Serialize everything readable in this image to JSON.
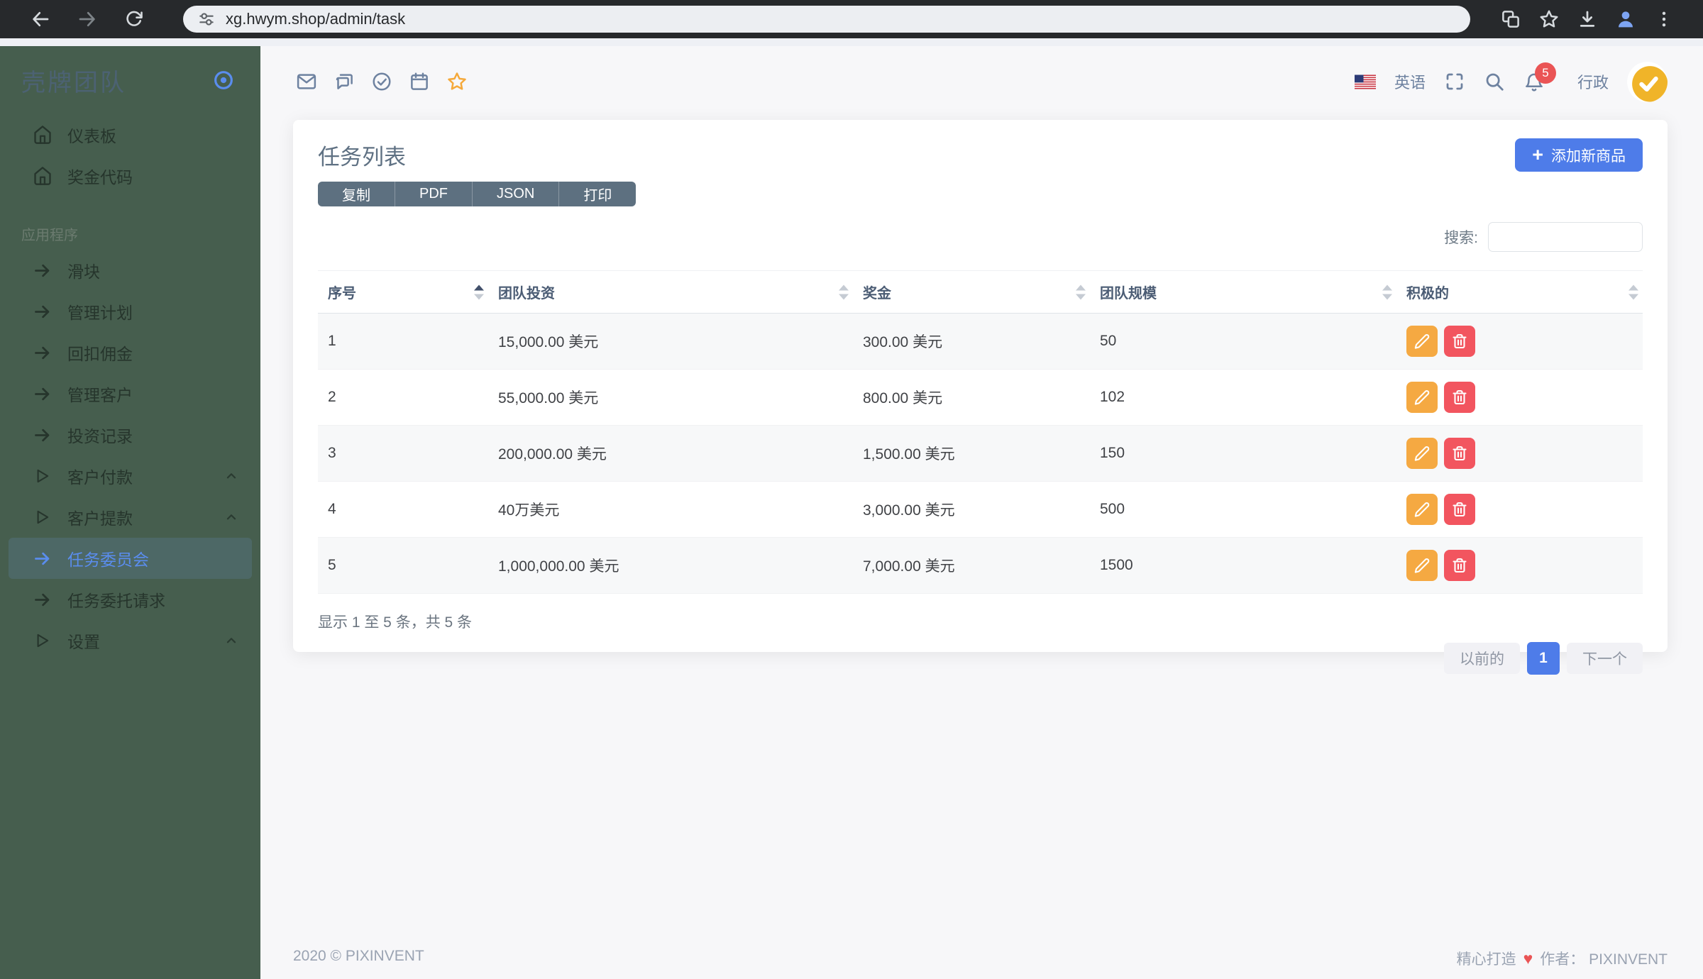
{
  "browser": {
    "url": "xg.hwym.shop/admin/task"
  },
  "sidebar": {
    "brand": "壳牌团队",
    "section_label": "应用程序",
    "items": [
      {
        "label": "仪表板",
        "icon": "home"
      },
      {
        "label": "奖金代码",
        "icon": "home"
      },
      {
        "label": "滑块",
        "icon": "arrow"
      },
      {
        "label": "管理计划",
        "icon": "arrow"
      },
      {
        "label": "回扣佣金",
        "icon": "arrow"
      },
      {
        "label": "管理客户",
        "icon": "arrow"
      },
      {
        "label": "投资记录",
        "icon": "arrow"
      },
      {
        "label": "客户付款",
        "icon": "triangle",
        "collapsible": true
      },
      {
        "label": "客户提款",
        "icon": "triangle",
        "collapsible": true
      },
      {
        "label": "任务委员会",
        "icon": "arrow",
        "active": true
      },
      {
        "label": "任务委托请求",
        "icon": "arrow"
      },
      {
        "label": "设置",
        "icon": "triangle",
        "collapsible": true
      }
    ]
  },
  "topbar": {
    "language": "英语",
    "notification_count": "5",
    "user_role": "行政"
  },
  "card": {
    "title": "任务列表",
    "export_buttons": [
      "复制",
      "PDF",
      "JSON",
      "打印"
    ],
    "add_button_label": "添加新商品",
    "search_label": "搜索:",
    "table": {
      "columns": [
        "序号",
        "团队投资",
        "奖金",
        "团队规模",
        "积极的"
      ],
      "rows": [
        [
          "1",
          "15,000.00 美元",
          "300.00 美元",
          "50"
        ],
        [
          "2",
          "55,000.00 美元",
          "800.00 美元",
          "102"
        ],
        [
          "3",
          "200,000.00 美元",
          "1,500.00 美元",
          "150"
        ],
        [
          "4",
          "40万美元",
          "3,000.00 美元",
          "500"
        ],
        [
          "5",
          "1,000,000.00 美元",
          "7,000.00 美元",
          "1500"
        ]
      ]
    },
    "info_text": "显示 1 至 5 条，共 5 条",
    "pagination": {
      "previous": "以前的",
      "page": "1",
      "next": "下一个"
    }
  },
  "footer": {
    "copyright": "2020 © PIXINVENT",
    "made_with": "精心打造",
    "author": "作者： PIXINVENT"
  },
  "colors": {
    "sidebar_bg": "#465e4e",
    "accent_blue": "#4e7ce9",
    "active_link": "#5a8dee",
    "edit_orange": "#f5a942",
    "delete_red": "#f2555f",
    "badge_red": "#ea5455",
    "star_orange": "#f5a93b"
  }
}
